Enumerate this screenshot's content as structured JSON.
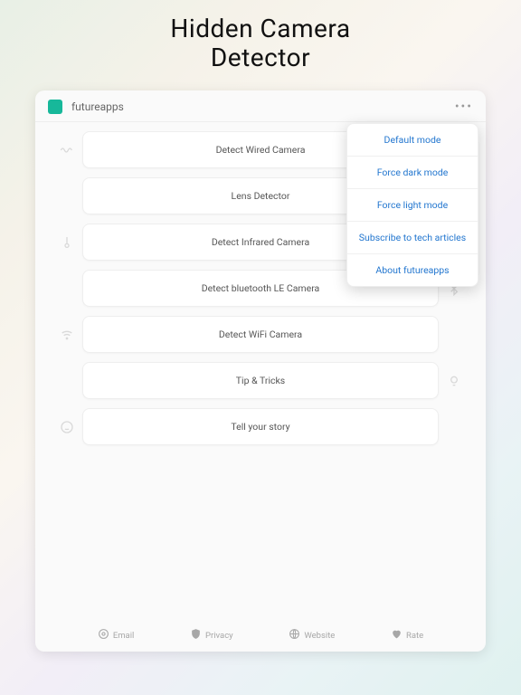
{
  "title_line1": "Hidden Camera",
  "title_line2": "Detector",
  "brand": "futureapps",
  "rows": [
    {
      "label": "Detect Wired Camera",
      "icon": "wave-icon",
      "side": "left"
    },
    {
      "label": "Lens Detector",
      "icon": "camera-icon",
      "side": "right"
    },
    {
      "label": "Detect Infrared Camera",
      "icon": "thermo-icon",
      "side": "left"
    },
    {
      "label": "Detect bluetooth LE Camera",
      "icon": "bluetooth-icon",
      "side": "right"
    },
    {
      "label": "Detect WiFi Camera",
      "icon": "wifi-icon",
      "side": "left"
    },
    {
      "label": "Tip & Tricks",
      "icon": "bulb-icon",
      "side": "right"
    },
    {
      "label": "Tell your story",
      "icon": "smile-icon",
      "side": "left"
    }
  ],
  "menu": [
    "Default mode",
    "Force dark mode",
    "Force light mode",
    "Subscribe to tech articles",
    "About futureapps"
  ],
  "footer": [
    {
      "label": "Email",
      "icon": "at-icon"
    },
    {
      "label": "Privacy",
      "icon": "shield-icon"
    },
    {
      "label": "Website",
      "icon": "globe-icon"
    },
    {
      "label": "Rate",
      "icon": "heart-icon"
    }
  ]
}
